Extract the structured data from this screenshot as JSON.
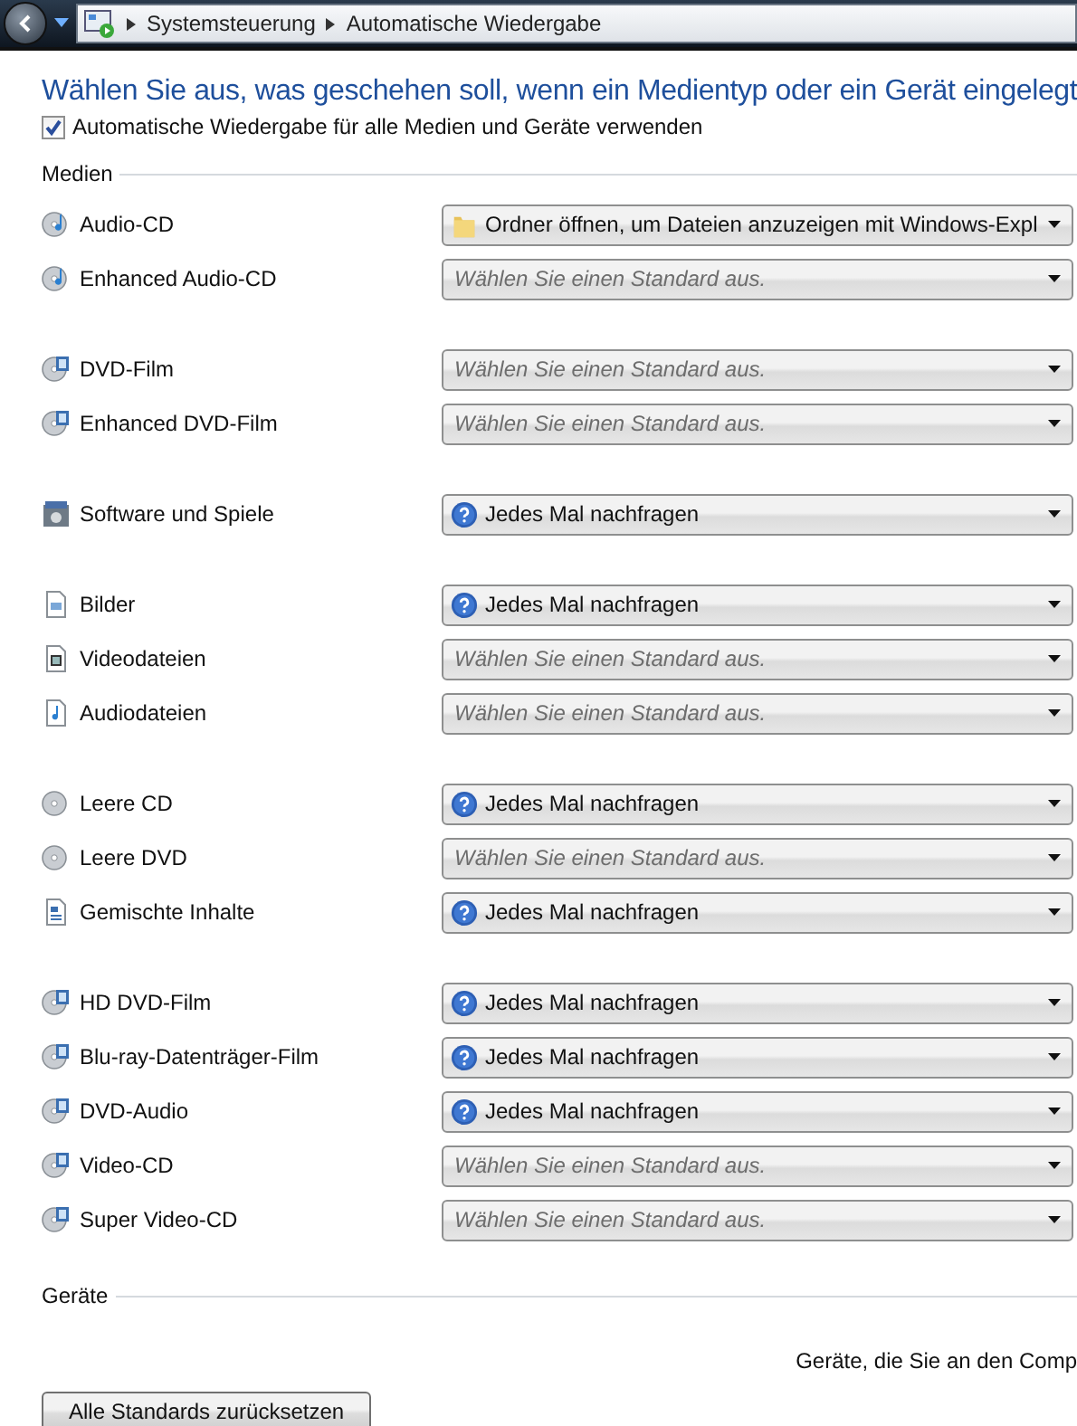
{
  "address_bar": {
    "breadcrumbs": [
      "Systemsteuerung",
      "Automatische Wiedergabe"
    ]
  },
  "heading": "Wählen Sie aus, was geschehen soll, wenn ein Medientyp oder ein Gerät eingelegt",
  "autoplay_all": {
    "label": "Automatische Wiedergabe für alle Medien und Geräte verwenden",
    "checked": true
  },
  "media": {
    "title": "Medien",
    "groups": [
      [
        {
          "name": "Audio-CD",
          "kind": "audio-disc",
          "choice": {
            "kind": "folder",
            "value": "Ordner öffnen, um Dateien anzuzeigen mit Windows-Expl"
          }
        },
        {
          "name": "Enhanced Audio-CD",
          "kind": "audio-disc",
          "choice": {
            "kind": "placeholder",
            "value": "Wählen Sie einen Standard aus."
          }
        }
      ],
      [
        {
          "name": "DVD-Film",
          "kind": "video-disc",
          "choice": {
            "kind": "placeholder",
            "value": "Wählen Sie einen Standard aus."
          }
        },
        {
          "name": "Enhanced DVD-Film",
          "kind": "video-disc",
          "choice": {
            "kind": "placeholder",
            "value": "Wählen Sie einen Standard aus."
          }
        }
      ],
      [
        {
          "name": "Software und Spiele",
          "kind": "software",
          "choice": {
            "kind": "ask",
            "value": "Jedes Mal nachfragen"
          }
        }
      ],
      [
        {
          "name": "Bilder",
          "kind": "picture-file",
          "choice": {
            "kind": "ask",
            "value": "Jedes Mal nachfragen"
          }
        },
        {
          "name": "Videodateien",
          "kind": "video-file",
          "choice": {
            "kind": "placeholder",
            "value": "Wählen Sie einen Standard aus."
          }
        },
        {
          "name": "Audiodateien",
          "kind": "audio-file",
          "choice": {
            "kind": "placeholder",
            "value": "Wählen Sie einen Standard aus."
          }
        }
      ],
      [
        {
          "name": "Leere CD",
          "kind": "blank-disc",
          "choice": {
            "kind": "ask",
            "value": "Jedes Mal nachfragen"
          }
        },
        {
          "name": "Leere DVD",
          "kind": "blank-disc",
          "choice": {
            "kind": "placeholder",
            "value": "Wählen Sie einen Standard aus."
          }
        },
        {
          "name": "Gemischte Inhalte",
          "kind": "mixed",
          "choice": {
            "kind": "ask",
            "value": "Jedes Mal nachfragen"
          }
        }
      ],
      [
        {
          "name": "HD DVD-Film",
          "kind": "video-disc",
          "choice": {
            "kind": "ask",
            "value": "Jedes Mal nachfragen"
          }
        },
        {
          "name": "Blu-ray-Datenträger-Film",
          "kind": "video-disc",
          "choice": {
            "kind": "ask",
            "value": "Jedes Mal nachfragen"
          }
        },
        {
          "name": "DVD-Audio",
          "kind": "video-disc",
          "choice": {
            "kind": "ask",
            "value": "Jedes Mal nachfragen"
          }
        },
        {
          "name": "Video-CD",
          "kind": "video-disc",
          "choice": {
            "kind": "placeholder",
            "value": "Wählen Sie einen Standard aus."
          }
        },
        {
          "name": "Super Video-CD",
          "kind": "video-disc",
          "choice": {
            "kind": "placeholder",
            "value": "Wählen Sie einen Standard aus."
          }
        }
      ]
    ]
  },
  "devices": {
    "title": "Geräte",
    "note": "Geräte, die Sie an den Comp"
  },
  "reset_button": "Alle Standards zurücksetzen"
}
